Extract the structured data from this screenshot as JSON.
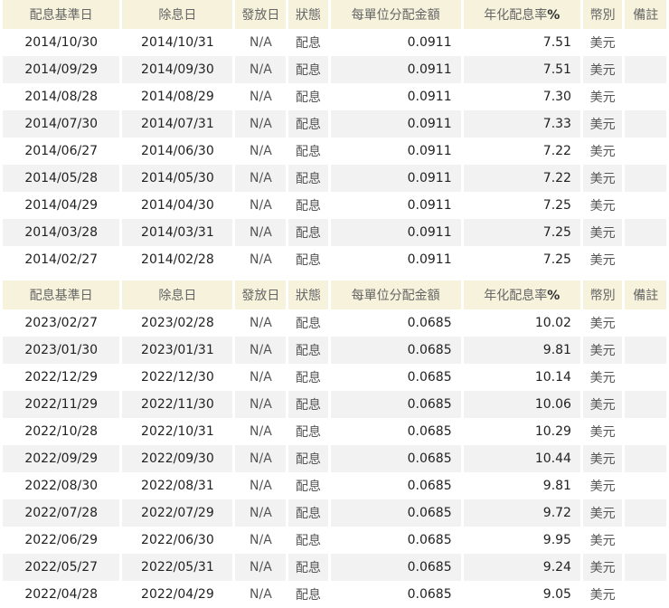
{
  "headers": [
    "配息基準日",
    "除息日",
    "發放日",
    "狀態",
    "每單位分配金額",
    "年化配息率",
    "%",
    "幣別",
    "備註"
  ],
  "tables": [
    {
      "rows": [
        [
          "2014/10/30",
          "2014/10/31",
          "N/A",
          "配息",
          "0.0911",
          "7.51",
          "美元",
          ""
        ],
        [
          "2014/09/29",
          "2014/09/30",
          "N/A",
          "配息",
          "0.0911",
          "7.51",
          "美元",
          ""
        ],
        [
          "2014/08/28",
          "2014/08/29",
          "N/A",
          "配息",
          "0.0911",
          "7.30",
          "美元",
          ""
        ],
        [
          "2014/07/30",
          "2014/07/31",
          "N/A",
          "配息",
          "0.0911",
          "7.33",
          "美元",
          ""
        ],
        [
          "2014/06/27",
          "2014/06/30",
          "N/A",
          "配息",
          "0.0911",
          "7.22",
          "美元",
          ""
        ],
        [
          "2014/05/28",
          "2014/05/30",
          "N/A",
          "配息",
          "0.0911",
          "7.22",
          "美元",
          ""
        ],
        [
          "2014/04/29",
          "2014/04/30",
          "N/A",
          "配息",
          "0.0911",
          "7.25",
          "美元",
          ""
        ],
        [
          "2014/03/28",
          "2014/03/31",
          "N/A",
          "配息",
          "0.0911",
          "7.25",
          "美元",
          ""
        ],
        [
          "2014/02/27",
          "2014/02/28",
          "N/A",
          "配息",
          "0.0911",
          "7.25",
          "美元",
          ""
        ]
      ]
    },
    {
      "rows": [
        [
          "2023/02/27",
          "2023/02/28",
          "N/A",
          "配息",
          "0.0685",
          "10.02",
          "美元",
          ""
        ],
        [
          "2023/01/30",
          "2023/01/31",
          "N/A",
          "配息",
          "0.0685",
          "9.81",
          "美元",
          ""
        ],
        [
          "2022/12/29",
          "2022/12/30",
          "N/A",
          "配息",
          "0.0685",
          "10.14",
          "美元",
          ""
        ],
        [
          "2022/11/29",
          "2022/11/30",
          "N/A",
          "配息",
          "0.0685",
          "10.06",
          "美元",
          ""
        ],
        [
          "2022/10/28",
          "2022/10/31",
          "N/A",
          "配息",
          "0.0685",
          "10.29",
          "美元",
          ""
        ],
        [
          "2022/09/29",
          "2022/09/30",
          "N/A",
          "配息",
          "0.0685",
          "10.44",
          "美元",
          ""
        ],
        [
          "2022/08/30",
          "2022/08/31",
          "N/A",
          "配息",
          "0.0685",
          "9.81",
          "美元",
          ""
        ],
        [
          "2022/07/28",
          "2022/07/29",
          "N/A",
          "配息",
          "0.0685",
          "9.72",
          "美元",
          ""
        ],
        [
          "2022/06/29",
          "2022/06/30",
          "N/A",
          "配息",
          "0.0685",
          "9.95",
          "美元",
          ""
        ],
        [
          "2022/05/27",
          "2022/05/31",
          "N/A",
          "配息",
          "0.0685",
          "9.24",
          "美元",
          ""
        ],
        [
          "2022/04/28",
          "2022/04/29",
          "N/A",
          "配息",
          "0.0685",
          "9.05",
          "美元",
          ""
        ]
      ]
    }
  ]
}
